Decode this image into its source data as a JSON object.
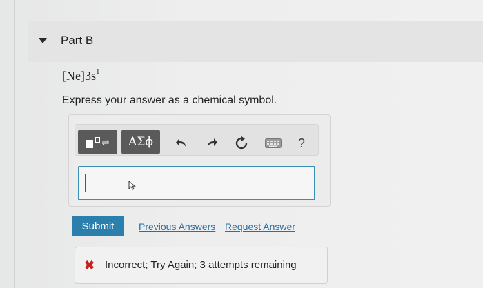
{
  "part": {
    "title": "Part B"
  },
  "question": {
    "formula_base": "[Ne]3s",
    "formula_sup": "1",
    "instruction": "Express your answer as a chemical symbol."
  },
  "toolbar": {
    "greek_label": "ΑΣϕ",
    "help_label": "?",
    "template_arrows": "⇌"
  },
  "answer": {
    "value": ""
  },
  "actions": {
    "submit_label": "Submit",
    "previous_answers_label": "Previous Answers",
    "request_answer_label": "Request Answer"
  },
  "feedback": {
    "mark": "✖",
    "text": "Incorrect; Try Again; 3 attempts remaining",
    "color": "#c8201a"
  },
  "colors": {
    "accent": "#2b7fad",
    "input_border": "#3a8fb7",
    "toolbar_button": "#5a5a5a"
  }
}
